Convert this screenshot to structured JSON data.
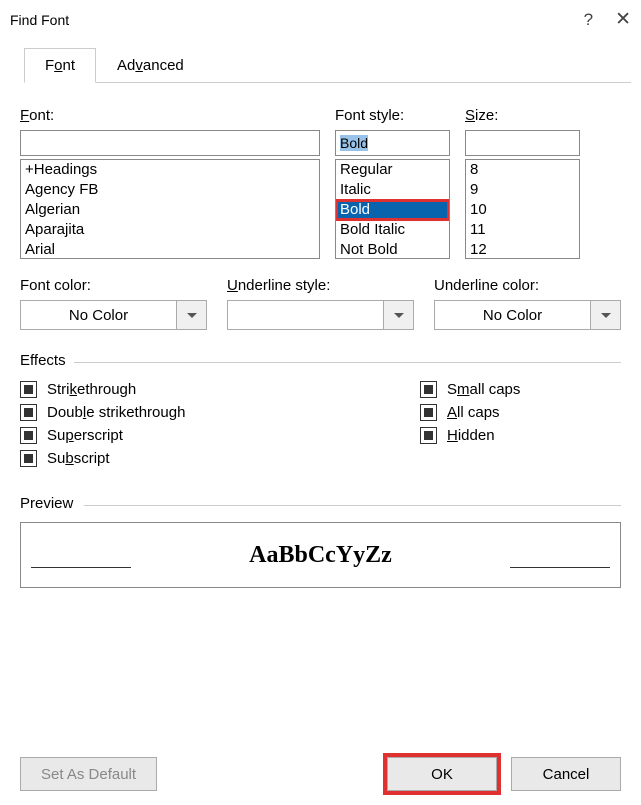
{
  "window": {
    "title": "Find Font"
  },
  "tabs": {
    "font": "Font",
    "advanced": "Advanced"
  },
  "labels": {
    "font": "Font:",
    "style": "Font style:",
    "size": "Size:",
    "fontcolor": "Font color:",
    "ulstyle": "Underline style:",
    "ulcolor": "Underline color:",
    "effects": "Effects",
    "preview": "Preview"
  },
  "font_input": "",
  "style_input": "Bold",
  "size_input": "",
  "font_list": [
    "+Headings",
    "Agency FB",
    "Algerian",
    "Aparajita",
    "Arial"
  ],
  "style_list": [
    "Regular",
    "Italic",
    "Bold",
    "Bold Italic",
    "Not Bold"
  ],
  "style_selected_index": 2,
  "size_list": [
    "8",
    "9",
    "10",
    "11",
    "12"
  ],
  "fontcolor_value": "No Color",
  "ulstyle_value": "",
  "ulcolor_value": "No Color",
  "effects": {
    "strike": "Strikethrough",
    "dstrike": "Double strikethrough",
    "super": "Superscript",
    "sub": "Subscript",
    "smallcaps": "Small caps",
    "allcaps": "All caps",
    "hidden": "Hidden"
  },
  "underline_map": {
    "strike_u": "k",
    "dstrike_u": "l",
    "super_u": "p",
    "sub_u": "b",
    "smallcaps_u": "m",
    "allcaps_u": "A",
    "hidden_u": "H",
    "font_u": "F",
    "adv_u": "v",
    "size_u": "S",
    "ulstyle_u": "U"
  },
  "preview_text": "AaBbCcYyZz",
  "buttons": {
    "default": "Set As Default",
    "ok": "OK",
    "cancel": "Cancel"
  }
}
